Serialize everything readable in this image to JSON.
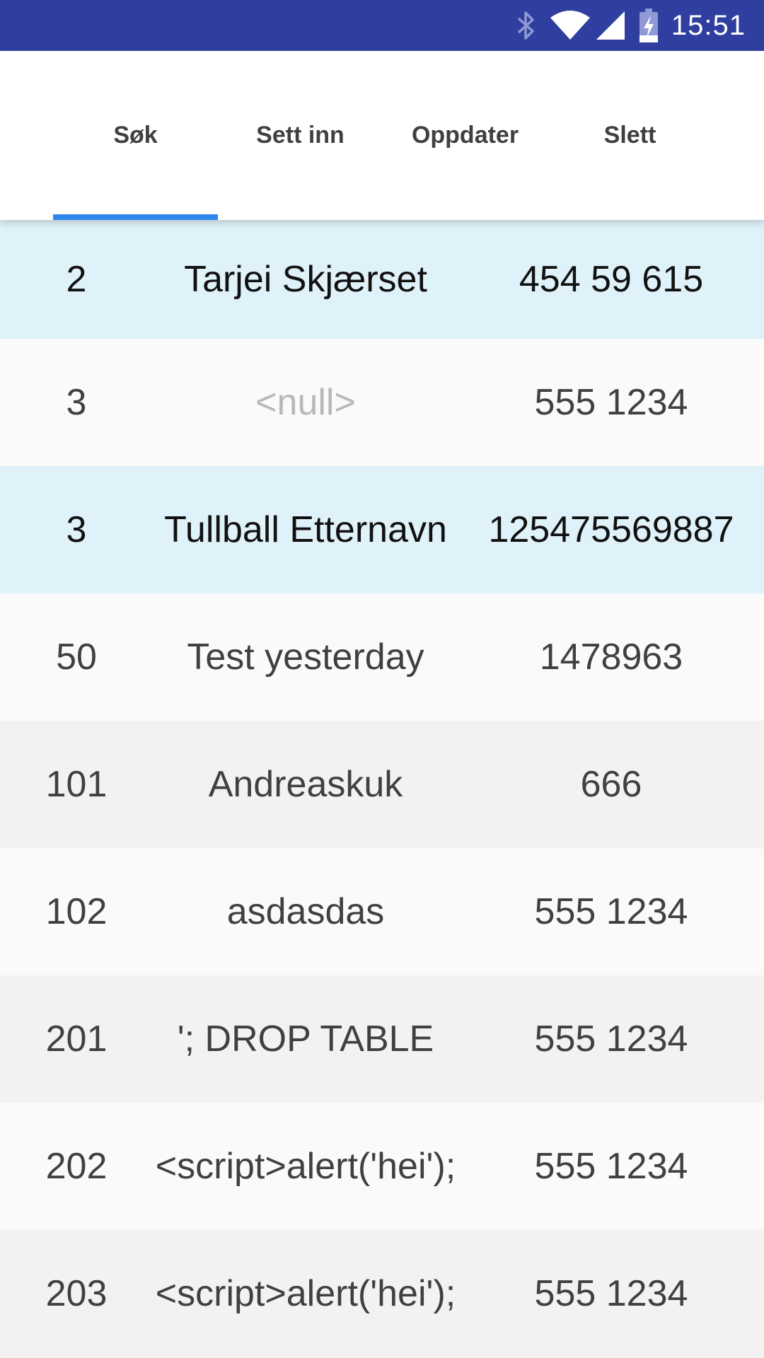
{
  "status_bar": {
    "time": "15:51",
    "icons": [
      "bluetooth-icon",
      "wifi-icon",
      "signal-icon",
      "battery-charging-icon"
    ],
    "background": "#303f9f"
  },
  "tabs": [
    {
      "label": "Søk",
      "selected": true
    },
    {
      "label": "Sett inn",
      "selected": false
    },
    {
      "label": "Oppdater",
      "selected": false
    },
    {
      "label": "Slett",
      "selected": false
    }
  ],
  "accent_color": "#2f86eb",
  "rows": [
    {
      "id": "2",
      "name": "Tarjei Skjærset",
      "phone": "454 59 615"
    },
    {
      "id": "3",
      "name": "<null>",
      "phone": "555 1234"
    },
    {
      "id": "3",
      "name": "Tullball Etternavn",
      "phone": "125475569887"
    },
    {
      "id": "50",
      "name": "Test yesterday",
      "phone": "1478963"
    },
    {
      "id": "101",
      "name": "Andreaskuk",
      "phone": "666"
    },
    {
      "id": "102",
      "name": "asdasdas",
      "phone": "555 1234"
    },
    {
      "id": "201",
      "name": "'; DROP TABLE",
      "phone": "555 1234"
    },
    {
      "id": "202",
      "name": "<script>alert('hei');",
      "phone": "555 1234"
    },
    {
      "id": "203",
      "name": "<script>alert('hei');",
      "phone": "555 1234"
    }
  ]
}
